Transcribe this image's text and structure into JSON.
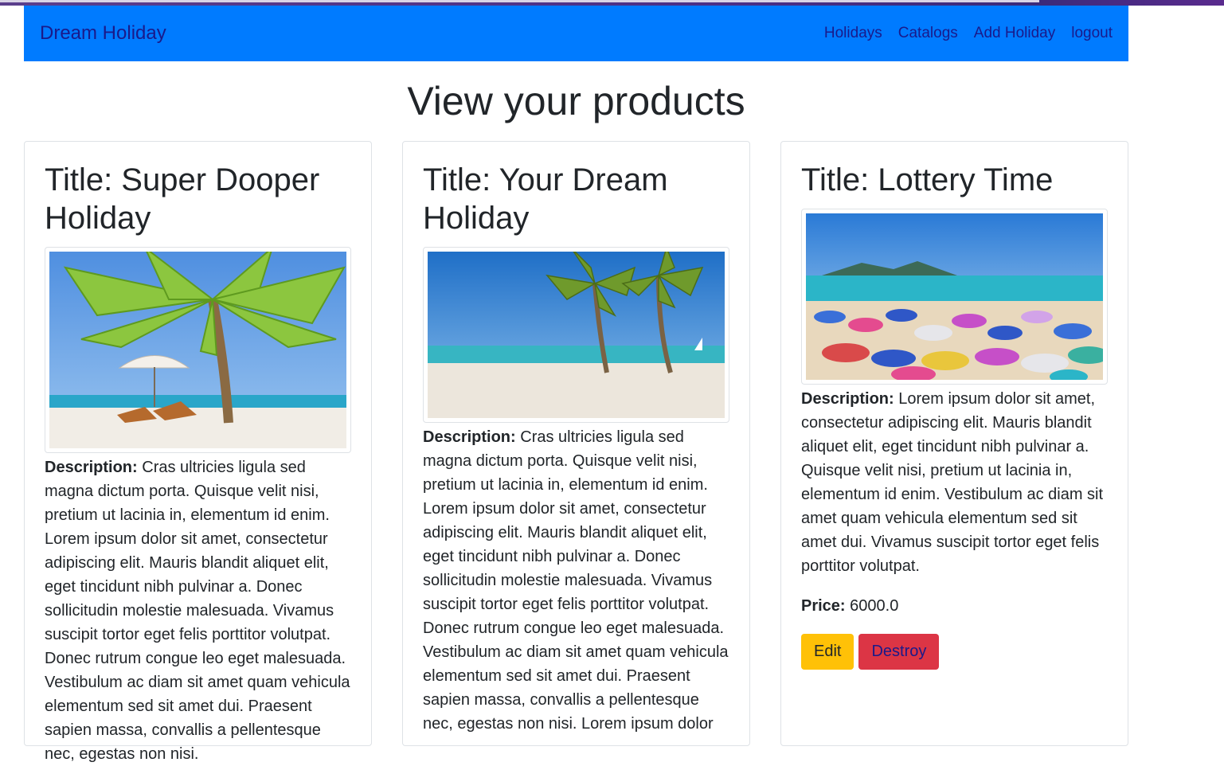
{
  "navbar": {
    "brand": "Dream Holiday",
    "links": [
      "Holidays",
      "Catalogs",
      "Add Holiday",
      "logout"
    ],
    "color": "#007bff"
  },
  "page_title": "View your products",
  "cards": [
    {
      "title": "Title: Super Dooper Holiday",
      "image_alt": "palm tree over beach with two sun loungers and umbrella",
      "description_label": "Description:",
      "description": " Cras ultricies ligula sed magna dictum porta. Quisque velit nisi, pretium ut lacinia in, elementum id enim. Lorem ipsum dolor sit amet, consectetur adipiscing elit. Mauris blandit aliquet elit, eget tincidunt nibh pulvinar a. Donec sollicitudin molestie malesuada. Vivamus suscipit tortor eget felis porttitor volutpat. Donec rutrum congue leo eget malesuada. Vestibulum ac diam sit amet quam vehicula elementum sed sit amet dui. Praesent sapien massa, convallis a pellentesque nec, egestas non nisi."
    },
    {
      "title": "Title: Your Dream Holiday",
      "image_alt": "two palm trees on white sand beach with sailboat",
      "description_label": "Description:",
      "description": " Cras ultricies ligula sed magna dictum porta. Quisque velit nisi, pretium ut lacinia in, elementum id enim. Lorem ipsum dolor sit amet, consectetur adipiscing elit. Mauris blandit aliquet elit, eget tincidunt nibh pulvinar a. Donec sollicitudin molestie malesuada. Vivamus suscipit tortor eget felis porttitor volutpat. Donec rutrum congue leo eget malesuada. Vestibulum ac diam sit amet quam vehicula elementum sed sit amet dui. Praesent sapien massa, convallis a pellentesque nec, egestas non nisi. Lorem ipsum dolor"
    },
    {
      "title": "Title: Lottery Time",
      "image_alt": "crowded beach with colorful umbrellas",
      "description_label": "Description:",
      "description": " Lorem ipsum dolor sit amet, consectetur adipiscing elit. Mauris blandit aliquet elit, eget tincidunt nibh pulvinar a. Quisque velit nisi, pretium ut lacinia in, elementum id enim. Vestibulum ac diam sit amet quam vehicula elementum sed sit amet dui. Vivamus suscipit tortor eget felis porttitor volutpat.",
      "price_label": "Price:",
      "price": " 6000.0",
      "edit_label": "Edit",
      "destroy_label": "Destroy"
    }
  ]
}
